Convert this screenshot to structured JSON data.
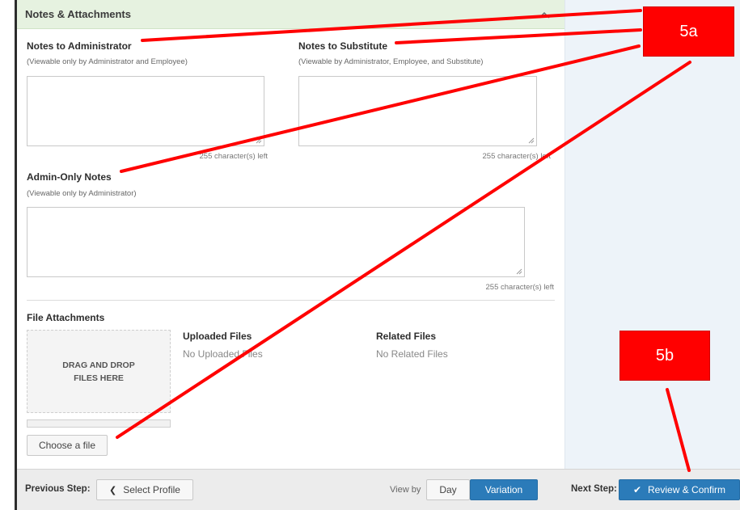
{
  "section": {
    "title": "Notes & Attachments",
    "collapse_icon": "chevron-up-icon"
  },
  "notes_admin": {
    "heading": "Notes to Administrator",
    "hint": "(Viewable only by Administrator and Employee)",
    "value": "",
    "count": "255 character(s) left"
  },
  "notes_sub": {
    "heading": "Notes to Substitute",
    "hint": "(Viewable by Administrator, Employee, and Substitute)",
    "value": "",
    "count": "255 character(s) left"
  },
  "admin_only": {
    "heading": "Admin-Only Notes",
    "hint": "(Viewable only by Administrator)",
    "value": "",
    "count": "255 character(s) left"
  },
  "files": {
    "heading": "File Attachments",
    "drop_text": "DRAG AND DROP FILES HERE",
    "uploaded_heading": "Uploaded Files",
    "uploaded_empty": "No Uploaded Files",
    "related_heading": "Related Files",
    "related_empty": "No Related Files",
    "choose_label": "Choose a file",
    "progress": 0
  },
  "footer": {
    "prev_label": "Previous Step:",
    "prev_button": "Select Profile",
    "view_by": "View by",
    "view_day": "Day",
    "view_variation": "Variation",
    "next_label": "Next Step:",
    "next_button": "Review & Confirm"
  },
  "callouts": {
    "a": "5a",
    "b": "5b"
  },
  "colors": {
    "accent": "#2b7bb9",
    "callout": "#ff0000",
    "header_bg": "#e6f2e0"
  }
}
